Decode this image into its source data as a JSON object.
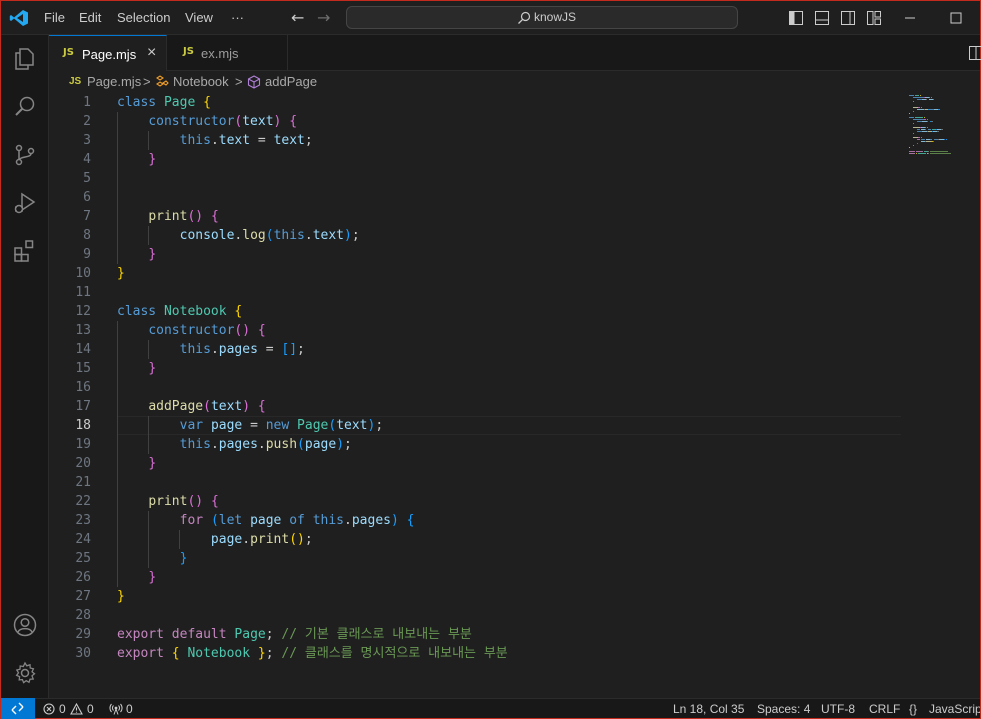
{
  "titlebar": {
    "menus": [
      "File",
      "Edit",
      "Selection",
      "View",
      "···"
    ],
    "search_text": "knowJS"
  },
  "tabs": [
    {
      "badge": "JS",
      "label": "Page.mjs",
      "active": true,
      "close": "×"
    },
    {
      "badge": "JS",
      "label": "ex.mjs",
      "active": false
    }
  ],
  "breadcrumb": {
    "file": "Page.mjs",
    "sep1": ">",
    "class": "Notebook",
    "sep2": ">",
    "method": "addPage"
  },
  "editor": {
    "current_line": 18,
    "lines": [
      [
        {
          "t": "class ",
          "s": "k"
        },
        {
          "t": "Page",
          "s": "c"
        },
        {
          "t": " ",
          "s": "p"
        },
        {
          "t": "{",
          "s": "b1"
        }
      ],
      [
        {
          "t": "    ",
          "s": "p"
        },
        {
          "t": "constructor",
          "s": "k"
        },
        {
          "t": "(",
          "s": "b2"
        },
        {
          "t": "text",
          "s": "v"
        },
        {
          "t": ")",
          "s": "b2"
        },
        {
          "t": " ",
          "s": "p"
        },
        {
          "t": "{",
          "s": "b2"
        }
      ],
      [
        {
          "t": "        ",
          "s": "p"
        },
        {
          "t": "this",
          "s": "k"
        },
        {
          "t": ".",
          "s": "p"
        },
        {
          "t": "text",
          "s": "v"
        },
        {
          "t": " = ",
          "s": "p"
        },
        {
          "t": "text",
          "s": "v"
        },
        {
          "t": ";",
          "s": "p"
        }
      ],
      [
        {
          "t": "    ",
          "s": "p"
        },
        {
          "t": "}",
          "s": "b2"
        }
      ],
      [],
      [],
      [
        {
          "t": "    ",
          "s": "p"
        },
        {
          "t": "print",
          "s": "f"
        },
        {
          "t": "()",
          "s": "b2"
        },
        {
          "t": " ",
          "s": "p"
        },
        {
          "t": "{",
          "s": "b2"
        }
      ],
      [
        {
          "t": "        ",
          "s": "p"
        },
        {
          "t": "console",
          "s": "v"
        },
        {
          "t": ".",
          "s": "p"
        },
        {
          "t": "log",
          "s": "f"
        },
        {
          "t": "(",
          "s": "b3"
        },
        {
          "t": "this",
          "s": "k"
        },
        {
          "t": ".",
          "s": "p"
        },
        {
          "t": "text",
          "s": "v"
        },
        {
          "t": ")",
          "s": "b3"
        },
        {
          "t": ";",
          "s": "p"
        }
      ],
      [
        {
          "t": "    ",
          "s": "p"
        },
        {
          "t": "}",
          "s": "b2"
        }
      ],
      [
        {
          "t": "}",
          "s": "b1"
        }
      ],
      [],
      [
        {
          "t": "class ",
          "s": "k"
        },
        {
          "t": "Notebook",
          "s": "c"
        },
        {
          "t": " ",
          "s": "p"
        },
        {
          "t": "{",
          "s": "b1"
        }
      ],
      [
        {
          "t": "    ",
          "s": "p"
        },
        {
          "t": "constructor",
          "s": "k"
        },
        {
          "t": "()",
          "s": "b2"
        },
        {
          "t": " ",
          "s": "p"
        },
        {
          "t": "{",
          "s": "b2"
        }
      ],
      [
        {
          "t": "        ",
          "s": "p"
        },
        {
          "t": "this",
          "s": "k"
        },
        {
          "t": ".",
          "s": "p"
        },
        {
          "t": "pages",
          "s": "v"
        },
        {
          "t": " = ",
          "s": "p"
        },
        {
          "t": "[]",
          "s": "b3"
        },
        {
          "t": ";",
          "s": "p"
        }
      ],
      [
        {
          "t": "    ",
          "s": "p"
        },
        {
          "t": "}",
          "s": "b2"
        }
      ],
      [],
      [
        {
          "t": "    ",
          "s": "p"
        },
        {
          "t": "addPage",
          "s": "f"
        },
        {
          "t": "(",
          "s": "b2"
        },
        {
          "t": "text",
          "s": "v"
        },
        {
          "t": ")",
          "s": "b2"
        },
        {
          "t": " ",
          "s": "p"
        },
        {
          "t": "{",
          "s": "b2"
        }
      ],
      [
        {
          "t": "        ",
          "s": "p"
        },
        {
          "t": "var ",
          "s": "k"
        },
        {
          "t": "page",
          "s": "v"
        },
        {
          "t": " = ",
          "s": "p"
        },
        {
          "t": "new ",
          "s": "k"
        },
        {
          "t": "Page",
          "s": "c"
        },
        {
          "t": "(",
          "s": "b3"
        },
        {
          "t": "text",
          "s": "v"
        },
        {
          "t": ")",
          "s": "b3"
        },
        {
          "t": ";",
          "s": "p"
        }
      ],
      [
        {
          "t": "        ",
          "s": "p"
        },
        {
          "t": "this",
          "s": "k"
        },
        {
          "t": ".",
          "s": "p"
        },
        {
          "t": "pages",
          "s": "v"
        },
        {
          "t": ".",
          "s": "p"
        },
        {
          "t": "push",
          "s": "f"
        },
        {
          "t": "(",
          "s": "b3"
        },
        {
          "t": "page",
          "s": "v"
        },
        {
          "t": ")",
          "s": "b3"
        },
        {
          "t": ";",
          "s": "p"
        }
      ],
      [
        {
          "t": "    ",
          "s": "p"
        },
        {
          "t": "}",
          "s": "b2"
        }
      ],
      [],
      [
        {
          "t": "    ",
          "s": "p"
        },
        {
          "t": "print",
          "s": "f"
        },
        {
          "t": "()",
          "s": "b2"
        },
        {
          "t": " ",
          "s": "p"
        },
        {
          "t": "{",
          "s": "b2"
        }
      ],
      [
        {
          "t": "        ",
          "s": "p"
        },
        {
          "t": "for ",
          "s": "kw"
        },
        {
          "t": "(",
          "s": "b3"
        },
        {
          "t": "let ",
          "s": "k"
        },
        {
          "t": "page",
          "s": "v"
        },
        {
          "t": " of ",
          "s": "k"
        },
        {
          "t": "this",
          "s": "k"
        },
        {
          "t": ".",
          "s": "p"
        },
        {
          "t": "pages",
          "s": "v"
        },
        {
          "t": ")",
          "s": "b3"
        },
        {
          "t": " ",
          "s": "p"
        },
        {
          "t": "{",
          "s": "b3"
        }
      ],
      [
        {
          "t": "            ",
          "s": "p"
        },
        {
          "t": "page",
          "s": "v"
        },
        {
          "t": ".",
          "s": "p"
        },
        {
          "t": "print",
          "s": "f"
        },
        {
          "t": "()",
          "s": "b1"
        },
        {
          "t": ";",
          "s": "p"
        }
      ],
      [
        {
          "t": "        ",
          "s": "p"
        },
        {
          "t": "}",
          "s": "b3"
        }
      ],
      [
        {
          "t": "    ",
          "s": "p"
        },
        {
          "t": "}",
          "s": "b2"
        }
      ],
      [
        {
          "t": "}",
          "s": "b1"
        }
      ],
      [],
      [
        {
          "t": "export ",
          "s": "kw"
        },
        {
          "t": "default ",
          "s": "kw"
        },
        {
          "t": "Page",
          "s": "c"
        },
        {
          "t": "; ",
          "s": "p"
        },
        {
          "t": "// 기본 클래스로 내보내는 부분",
          "s": "cm"
        }
      ],
      [
        {
          "t": "export ",
          "s": "kw"
        },
        {
          "t": "{",
          "s": "b1"
        },
        {
          "t": " ",
          "s": "p"
        },
        {
          "t": "Notebook",
          "s": "c"
        },
        {
          "t": " ",
          "s": "p"
        },
        {
          "t": "}",
          "s": "b1"
        },
        {
          "t": "; ",
          "s": "p"
        },
        {
          "t": "// 클래스를 명시적으로 내보내는 부분",
          "s": "cm"
        }
      ]
    ]
  },
  "statusbar": {
    "errors": "0",
    "warnings": "0",
    "ports": "0",
    "position": "Ln 18, Col 35",
    "spaces": "Spaces: 4",
    "encoding": "UTF-8",
    "eol": "CRLF",
    "language_icon": "{}",
    "language": "JavaScript"
  },
  "colors": {
    "accent": "#0078d4",
    "keyword": "#569cd6",
    "class": "#4ec9b0",
    "function": "#dcdcaa",
    "variable": "#9cdcfe",
    "comment": "#6a9955",
    "control": "#c586c0"
  }
}
